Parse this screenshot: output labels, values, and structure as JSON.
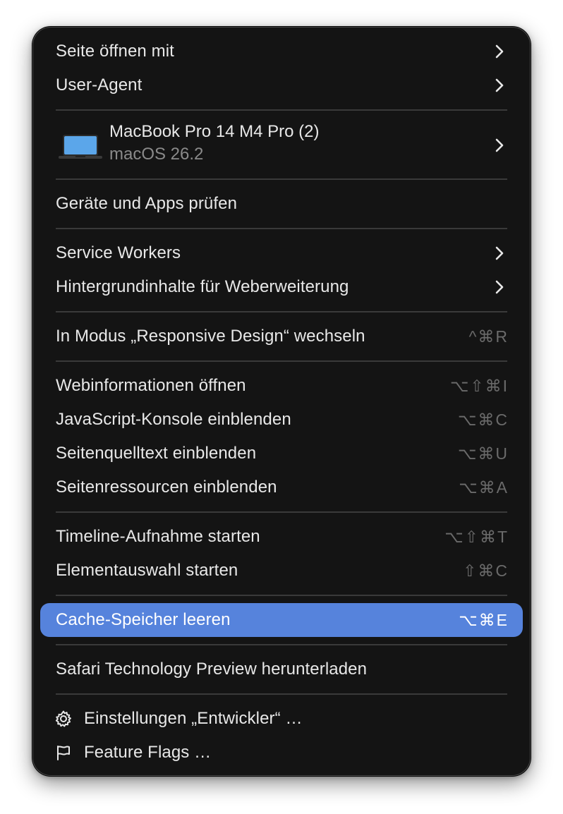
{
  "menu": {
    "items": [
      {
        "label": "Seite öffnen mit"
      },
      {
        "label": "User-Agent"
      },
      {
        "label": "Geräte und Apps prüfen"
      },
      {
        "label": "Service Workers"
      },
      {
        "label": "Hintergrundinhalte für Weberweiterung"
      },
      {
        "label": "In Modus „Responsive Design“ wechseln",
        "shortcut": "^⌘R"
      },
      {
        "label": "Webinformationen öffnen",
        "shortcut": "⌥⇧⌘I"
      },
      {
        "label": "JavaScript-Konsole einblenden",
        "shortcut": "⌥⌘C"
      },
      {
        "label": "Seitenquelltext einblenden",
        "shortcut": "⌥⌘U"
      },
      {
        "label": "Seitenressourcen einblenden",
        "shortcut": "⌥⌘A"
      },
      {
        "label": "Timeline-Aufnahme starten",
        "shortcut": "⌥⇧⌘T"
      },
      {
        "label": "Elementauswahl starten",
        "shortcut": "⇧⌘C"
      },
      {
        "label": "Cache-Speicher leeren",
        "shortcut": "⌥⌘E",
        "highlighted": true
      },
      {
        "label": "Safari Technology Preview herunterladen"
      },
      {
        "label": "Einstellungen „Entwickler“ …",
        "icon": "gear-icon"
      },
      {
        "label": "Feature Flags …",
        "icon": "flag-icon"
      }
    ],
    "device": {
      "name": "MacBook Pro 14 M4 Pro (2)",
      "os": "macOS 26.2",
      "icon": "laptop-icon"
    }
  },
  "colors": {
    "menu_background": "#141414",
    "highlight": "#5683dc",
    "text": "#e8e8e8",
    "shortcut_text": "#6a6a6a",
    "separator": "#3a3a3a"
  }
}
